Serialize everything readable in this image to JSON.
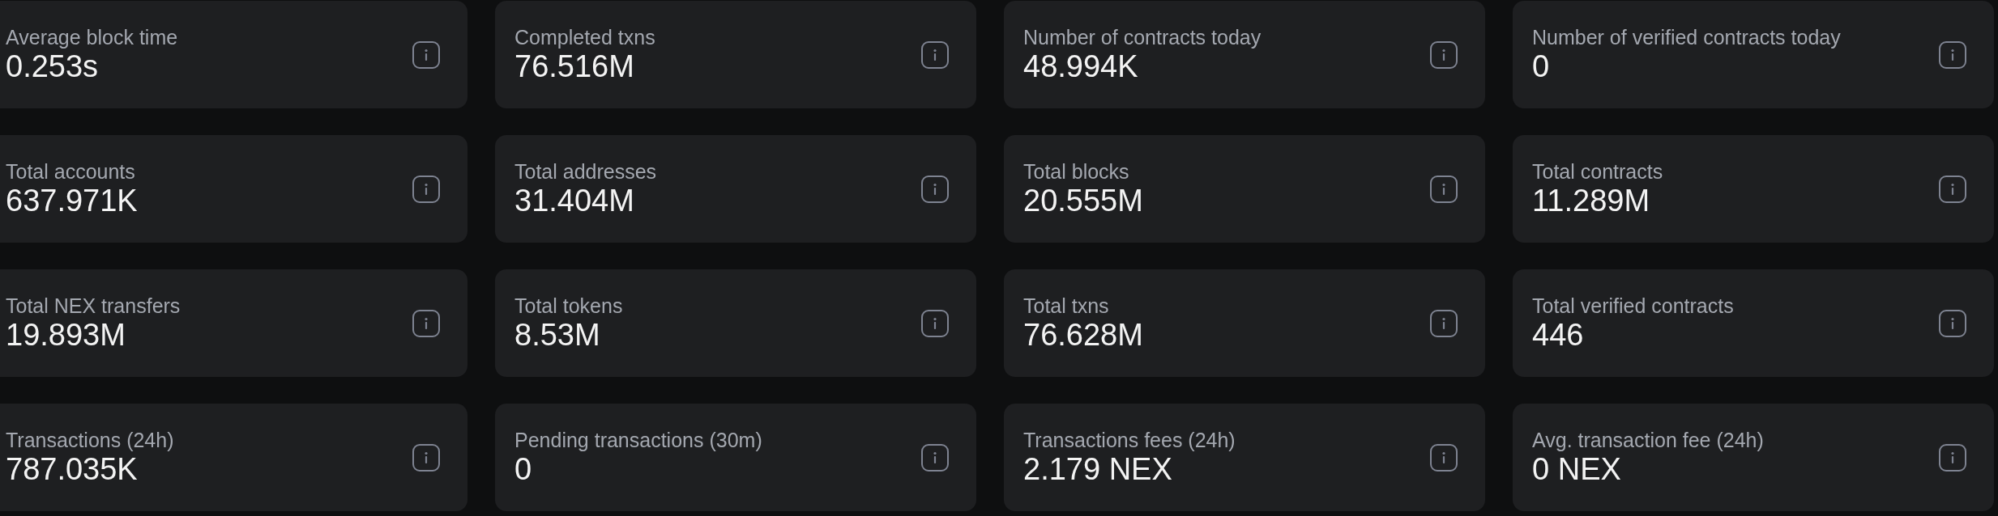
{
  "stats": [
    {
      "label": "Average block time",
      "value": "0.253s"
    },
    {
      "label": "Completed txns",
      "value": "76.516M"
    },
    {
      "label": "Number of contracts today",
      "value": "48.994K"
    },
    {
      "label": "Number of verified contracts today",
      "value": "0"
    },
    {
      "label": "Total accounts",
      "value": "637.971K"
    },
    {
      "label": "Total addresses",
      "value": "31.404M"
    },
    {
      "label": "Total blocks",
      "value": "20.555M"
    },
    {
      "label": "Total contracts",
      "value": "11.289M"
    },
    {
      "label": "Total NEX transfers",
      "value": "19.893M"
    },
    {
      "label": "Total tokens",
      "value": "8.53M"
    },
    {
      "label": "Total txns",
      "value": "76.628M"
    },
    {
      "label": "Total verified contracts",
      "value": "446"
    },
    {
      "label": "Transactions (24h)",
      "value": "787.035K"
    },
    {
      "label": "Pending transactions (30m)",
      "value": "0"
    },
    {
      "label": "Transactions fees (24h)",
      "value": "2.179 NEX"
    },
    {
      "label": "Avg. transaction fee (24h)",
      "value": "0 NEX"
    }
  ]
}
